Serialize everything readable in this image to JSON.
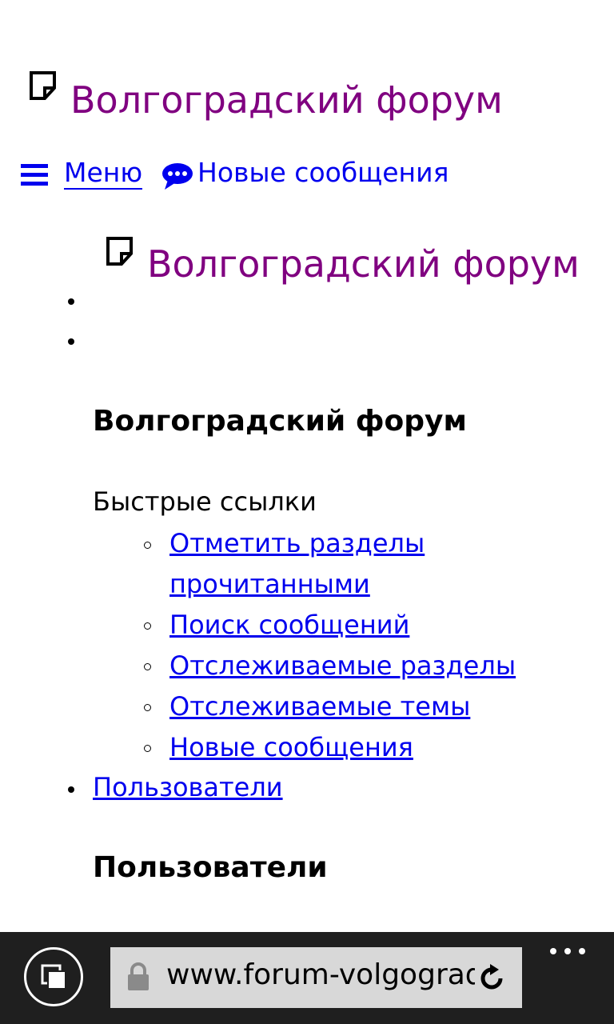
{
  "header": {
    "site_title": "Волгоградский форум",
    "menu_label": " Меню",
    "new_posts_label": "Новые сообщения"
  },
  "nav": {
    "logo_title": "Волгоградский форум",
    "forum_heading": "Волгоградский форум",
    "quick_links_label": "Быстрые ссылки",
    "quick_links": [
      "Отметить разделы",
      "прочитанными",
      "Поиск сообщений",
      "Отслеживаемые разделы",
      "Отслеживаемые темы",
      "Новые сообщения"
    ],
    "members_link": "Пользователи",
    "members_heading": "Пользователи"
  },
  "browser": {
    "url": "www.forum-volgograd",
    "icons": [
      "tabs-icon",
      "lock-icon",
      "refresh-icon",
      "more-icon"
    ]
  },
  "colors": {
    "visited_link": "#800080",
    "link": "#0000ee",
    "browser_bar": "#1f1f1f",
    "address_bar": "#d8d8d8"
  }
}
